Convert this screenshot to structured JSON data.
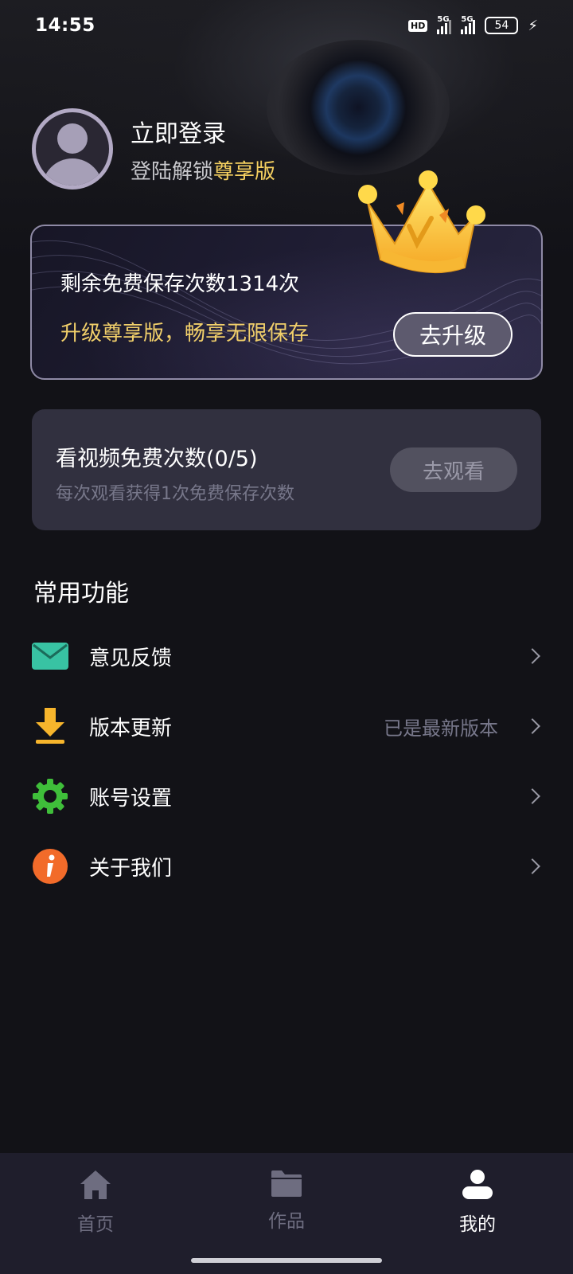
{
  "status_bar": {
    "time": "14:55",
    "hd": "HD",
    "signal1": "5G",
    "signal2": "5G",
    "battery": "54"
  },
  "profile": {
    "title": "立即登录",
    "subtitle_prefix": "登陆解锁",
    "subtitle_highlight": "尊享版"
  },
  "vip_card": {
    "remaining": "剩余免费保存次数1314次",
    "promo": "升级尊享版，畅享无限保存",
    "upgrade_button": "去升级"
  },
  "video_card": {
    "title": "看视频免费次数(0/5)",
    "subtitle": "每次观看获得1次免费保存次数",
    "watch_button": "去观看"
  },
  "section": {
    "title": "常用功能"
  },
  "menu": [
    {
      "label": "意见反馈",
      "value": "",
      "icon": "mail-icon"
    },
    {
      "label": "版本更新",
      "value": "已是最新版本",
      "icon": "download-icon"
    },
    {
      "label": "账号设置",
      "value": "",
      "icon": "gear-icon"
    },
    {
      "label": "关于我们",
      "value": "",
      "icon": "info-icon"
    }
  ],
  "bottom_nav": [
    {
      "label": "首页",
      "icon": "home-icon",
      "active": false
    },
    {
      "label": "作品",
      "icon": "folder-icon",
      "active": false
    },
    {
      "label": "我的",
      "icon": "user-icon",
      "active": true
    }
  ],
  "colors": {
    "background": "#121217",
    "gold": "#f5d060",
    "card": "#31303f",
    "nav_bg": "#1f1e2c"
  }
}
